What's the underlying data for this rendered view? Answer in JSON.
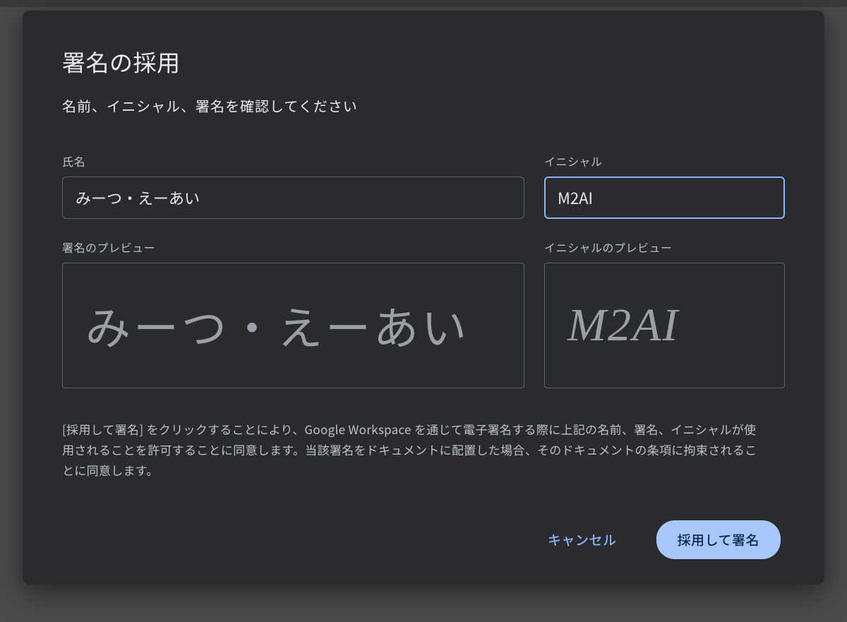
{
  "modal": {
    "title": "署名の採用",
    "subtitle": "名前、イニシャル、署名を確認してください",
    "name_label": "氏名",
    "name_value": "みーつ・えーあい",
    "initials_label": "イニシャル",
    "initials_value": "M2AI",
    "signature_preview_label": "署名のプレビュー",
    "signature_preview_value": "みーつ・えーあい",
    "initials_preview_label": "イニシャルのプレビュー",
    "initials_preview_value": "M2AI",
    "consent_text": "[採用して署名] をクリックすることにより、Google Workspace を通じて電子署名する際に上記の名前、署名、イニシャルが使用されることを許可することに同意します。当該署名をドキュメントに配置した場合、そのドキュメントの条項に拘束されることに同意します。",
    "cancel_label": "キャンセル",
    "adopt_label": "採用して署名"
  },
  "colors": {
    "modal_bg": "#2a2b2e",
    "text": "#e8eaed",
    "muted": "#bdc1c6",
    "border": "#5f6368",
    "focus": "#8ab4f8",
    "primary_bg": "#a8c7fa",
    "primary_text": "#0b2a57"
  }
}
